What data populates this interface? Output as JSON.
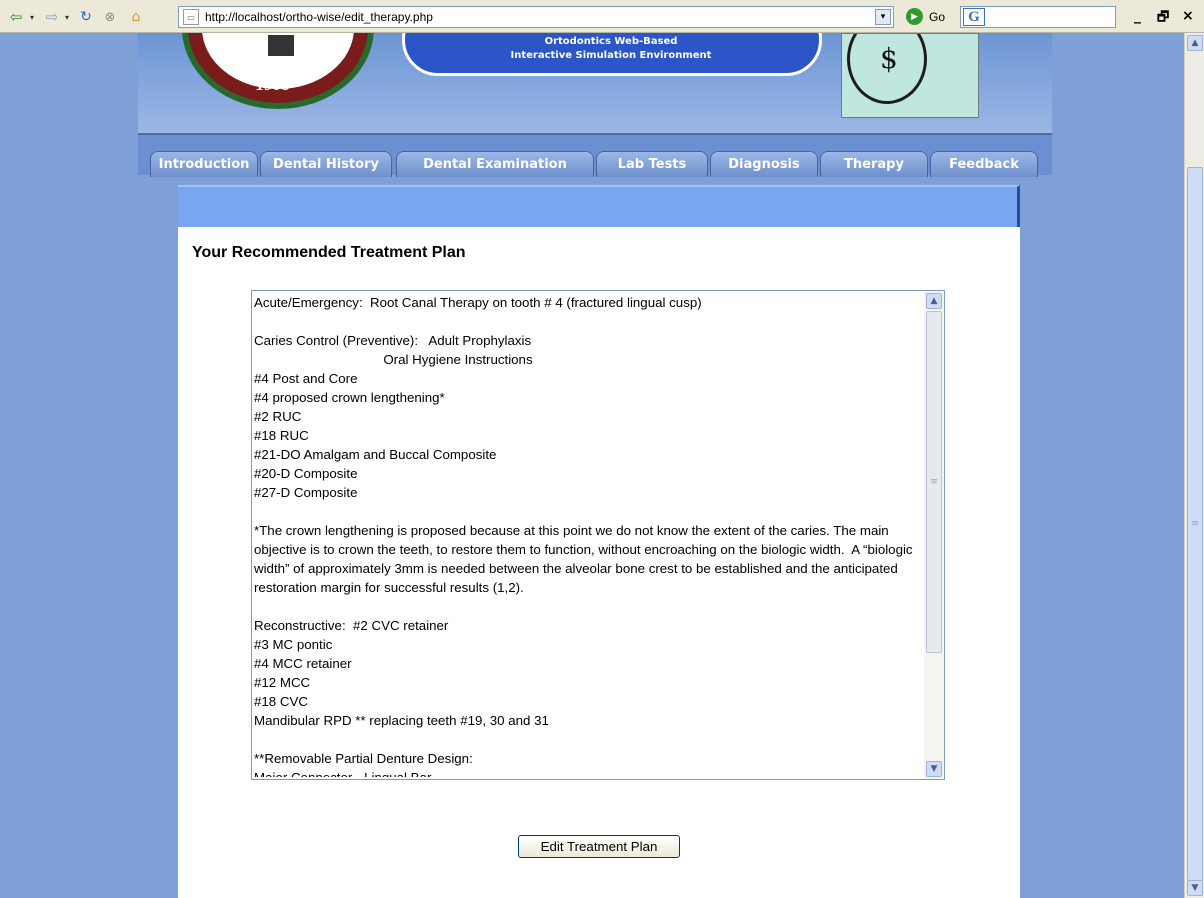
{
  "browser": {
    "url": "http://localhost/ortho-wise/edit_therapy.php",
    "go_label": "Go",
    "search_logo": "G",
    "icons": {
      "back": "back-arrow-icon",
      "forward": "forward-arrow-icon",
      "reload": "reload-icon",
      "stop": "stop-icon",
      "home": "home-icon",
      "go": "go-icon"
    },
    "window_controls": [
      "_",
      "🗗",
      "×"
    ]
  },
  "header": {
    "banner_line1": "Ortodontics Web-Based",
    "banner_line2": "Interactive Simulation Environment",
    "seal_text": "1908"
  },
  "tabs": [
    {
      "label": "Introduction"
    },
    {
      "label": "Dental History"
    },
    {
      "label": "Dental Examination"
    },
    {
      "label": "Lab Tests"
    },
    {
      "label": "Diagnosis"
    },
    {
      "label": "Therapy"
    },
    {
      "label": "Feedback"
    }
  ],
  "content": {
    "title": "Your Recommended Treatment Plan",
    "treatment_text": "Acute/Emergency:  Root Canal Therapy on tooth # 4 (fractured lingual cusp)\n\nCaries Control (Preventive):   Adult Prophylaxis\n                                   Oral Hygiene Instructions\n#4 Post and Core\n#4 proposed crown lengthening*\n#2 RUC\n#18 RUC\n#21-DO Amalgam and Buccal Composite\n#20-D Composite\n#27-D Composite\n\n*The crown lengthening is proposed because at this point we do not know the extent of the caries. The main objective is to crown the teeth, to restore them to function, without encroaching on the biologic width.  A “biologic width” of approximately 3mm is needed between the alveolar bone crest to be established and the anticipated restoration margin for successful results (1,2).\n\nReconstructive:  #2 CVC retainer\n#3 MC pontic\n#4 MCC retainer\n#12 MCC\n#18 CVC\nMandibular RPD ** replacing teeth #19, 30 and 31\n\n**Removable Partial Denture Design:\nMajor Connector - Lingual Bar",
    "edit_button": "Edit Treatment Plan"
  }
}
